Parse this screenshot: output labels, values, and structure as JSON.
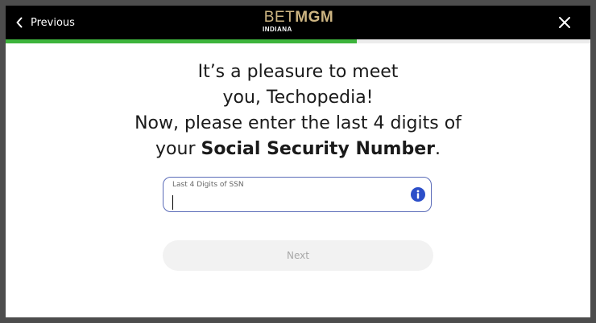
{
  "header": {
    "previous_label": "Previous",
    "logo": {
      "bet": "BET",
      "mgm": "MGM",
      "subtitle": "INDIANA"
    },
    "close_icon": "close-icon"
  },
  "progress": {
    "percent": 60,
    "color": "#3db43c"
  },
  "headline": {
    "line1": "It’s a pleasure to meet",
    "line2": "you, Techopedia!",
    "line3": "Now, please enter the last 4 digits of",
    "line4_prefix": "your ",
    "line4_bold": "Social Security Number",
    "line4_suffix": "."
  },
  "ssn_field": {
    "label": "Last 4 Digits of SSN",
    "value": "",
    "info_icon": "info-icon"
  },
  "next_button": {
    "label": "Next"
  },
  "colors": {
    "brand_gold": "#cdb582",
    "field_border": "#5a6bb8",
    "info_blue": "#2c4fc9"
  }
}
